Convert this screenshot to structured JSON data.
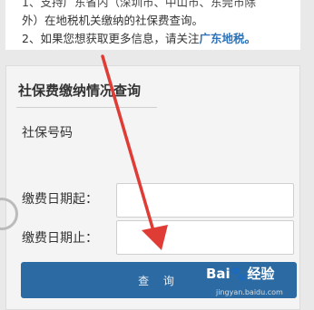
{
  "notice": {
    "line1": "1、支持广东省内（深圳市、中山市、东莞市除",
    "line2": "外）在地税机关缴纳的社保费查询。",
    "line3_prefix": "2、如果您想获取更多信息，请关注",
    "line3_link": "广东地税。"
  },
  "form": {
    "title": "社保费缴纳情况查询",
    "ssn_label": "社保号码",
    "start_label": "缴费日期起：",
    "end_label": "缴费日期止：",
    "submit_label": "查 询"
  },
  "watermark": {
    "logo": "Bai🐾经验",
    "url": "jingyan.baidu.com"
  },
  "colors": {
    "button": "#2b6aa3",
    "link": "#2e73b8",
    "arrow": "#e03c36"
  }
}
